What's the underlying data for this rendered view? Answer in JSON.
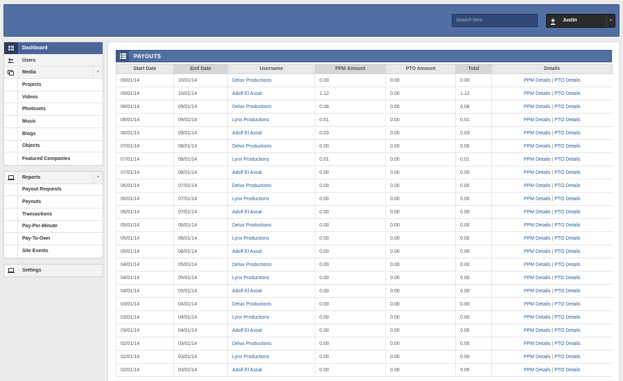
{
  "header": {
    "search_placeholder": "Search here",
    "user_name": "Justin"
  },
  "sidebar": {
    "groups": [
      {
        "items": [
          {
            "label": "Dashboard",
            "icon": "dashboard-icon",
            "active": true
          },
          {
            "label": "Users",
            "icon": "users-icon"
          },
          {
            "label": "Media",
            "icon": "media-icon",
            "expandable": true
          },
          {
            "label": "Projects",
            "sub": true
          },
          {
            "label": "Videos",
            "sub": true
          },
          {
            "label": "Photosets",
            "sub": true
          },
          {
            "label": "Music",
            "sub": true
          },
          {
            "label": "Blogs",
            "sub": true
          },
          {
            "label": "Objects",
            "sub": true
          },
          {
            "label": "Featured Companies",
            "sub": true
          }
        ]
      },
      {
        "items": [
          {
            "label": "Reports",
            "icon": "laptop-icon",
            "expandable": true
          },
          {
            "label": "Payout Requests",
            "sub": true
          },
          {
            "label": "Payouts",
            "sub": true
          },
          {
            "label": "Transactions",
            "sub": true
          },
          {
            "label": "Pay-Per-Minute",
            "sub": true
          },
          {
            "label": "Pay-To-Own",
            "sub": true
          },
          {
            "label": "Site Events",
            "sub": true
          }
        ]
      },
      {
        "items": [
          {
            "label": "Settings",
            "icon": "laptop-icon"
          }
        ]
      }
    ]
  },
  "panel": {
    "title": "PAYOUTS",
    "columns": [
      "Start Date",
      "End Date",
      "Username",
      "PPM Amount",
      "PTO Amount",
      "Total",
      "Details"
    ],
    "details_ppm": "PPM Details",
    "details_sep": "|",
    "details_pto": "PTO Details",
    "rows": [
      [
        "09/01/14",
        "10/01/14",
        "Delux Productions",
        "0.00",
        "0.00",
        "0.00"
      ],
      [
        "09/01/14",
        "10/01/14",
        "Adolf El Assal",
        "1.12",
        "0.00",
        "1.12"
      ],
      [
        "08/01/14",
        "09/01/14",
        "Delux Productions",
        "0.08",
        "0.00",
        "0.08"
      ],
      [
        "08/01/14",
        "09/01/14",
        "Lynx Productions",
        "0.01",
        "0.00",
        "0.01"
      ],
      [
        "08/01/14",
        "09/01/14",
        "Adolf El Assal",
        "0.03",
        "0.00",
        "0.03"
      ],
      [
        "07/01/14",
        "08/01/14",
        "Delux Productions",
        "0.00",
        "0.00",
        "0.00"
      ],
      [
        "07/01/14",
        "08/01/14",
        "Lynx Productions",
        "0.01",
        "0.00",
        "0.01"
      ],
      [
        "07/01/14",
        "08/01/14",
        "Adolf El Assal",
        "0.00",
        "0.00",
        "0.00"
      ],
      [
        "06/01/14",
        "07/01/14",
        "Delux Productions",
        "0.00",
        "0.00",
        "0.00"
      ],
      [
        "06/01/14",
        "07/01/14",
        "Lynx Productions",
        "0.00",
        "0.00",
        "0.00"
      ],
      [
        "06/01/14",
        "07/01/14",
        "Adolf El Assal",
        "0.00",
        "0.00",
        "0.00"
      ],
      [
        "05/01/14",
        "06/01/14",
        "Delux Productions",
        "0.00",
        "0.00",
        "0.00"
      ],
      [
        "05/01/14",
        "06/01/14",
        "Lynx Productions",
        "0.00",
        "0.00",
        "0.00"
      ],
      [
        "05/01/14",
        "06/01/14",
        "Adolf El Assal",
        "0.00",
        "0.00",
        "0.00"
      ],
      [
        "04/01/14",
        "05/01/14",
        "Delux Productions",
        "0.00",
        "0.00",
        "0.00"
      ],
      [
        "04/01/14",
        "05/01/14",
        "Lynx Productions",
        "0.00",
        "0.00",
        "0.00"
      ],
      [
        "04/01/14",
        "05/01/14",
        "Adolf El Assal",
        "0.00",
        "0.00",
        "0.00"
      ],
      [
        "03/01/14",
        "04/01/14",
        "Delux Productions",
        "0.00",
        "0.00",
        "0.00"
      ],
      [
        "03/01/14",
        "04/01/14",
        "Lynx Productions",
        "0.00",
        "0.00",
        "0.00"
      ],
      [
        "03/01/14",
        "04/01/14",
        "Adolf El Assal",
        "0.00",
        "0.00",
        "0.00"
      ],
      [
        "02/01/14",
        "03/01/14",
        "Delux Productions",
        "0.00",
        "0.00",
        "0.00"
      ],
      [
        "02/01/14",
        "03/01/14",
        "Lynx Productions",
        "0.00",
        "0.00",
        "0.00"
      ],
      [
        "02/01/14",
        "03/01/14",
        "Adolf El Assal",
        "0.00",
        "0.00",
        "0.00"
      ]
    ]
  }
}
